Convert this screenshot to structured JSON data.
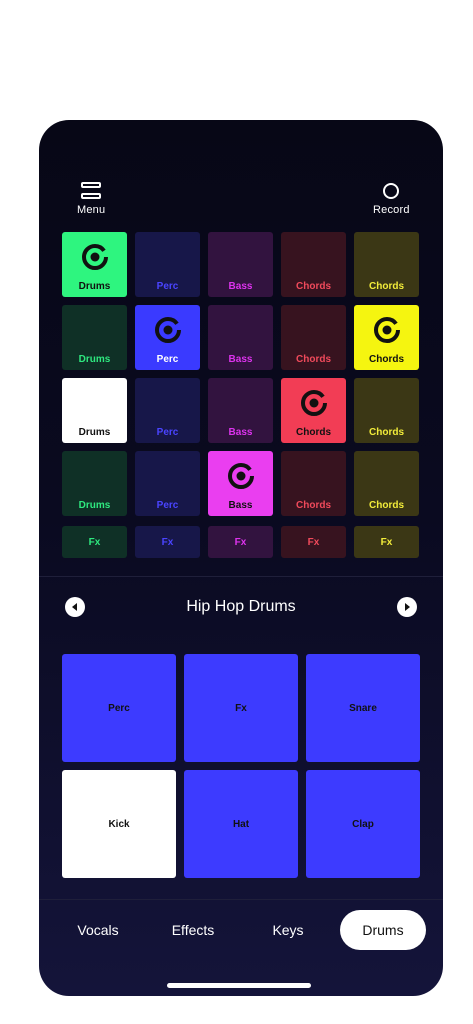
{
  "header": {
    "menu_label": "Menu",
    "record_label": "Record"
  },
  "launch_grid": {
    "rows": [
      [
        {
          "label": "Drums",
          "bg": "#2ef57f",
          "fg": "#111111",
          "active": true
        },
        {
          "label": "Perc",
          "bg": "#171749",
          "fg": "#4a44ff",
          "active": false
        },
        {
          "label": "Bass",
          "bg": "#32133f",
          "fg": "#dd33ee",
          "active": false
        },
        {
          "label": "Chords",
          "bg": "#37131f",
          "fg": "#f04a5b",
          "active": false
        },
        {
          "label": "Chords",
          "bg": "#3b3715",
          "fg": "#f2ec3a",
          "active": false
        }
      ],
      [
        {
          "label": "Drums",
          "bg": "#0f3026",
          "fg": "#2ee87f",
          "active": false
        },
        {
          "label": "Perc",
          "bg": "#3a3aff",
          "fg": "#ffffff",
          "active": true
        },
        {
          "label": "Bass",
          "bg": "#32133f",
          "fg": "#dd33ee",
          "active": false
        },
        {
          "label": "Chords",
          "bg": "#37131f",
          "fg": "#f04a5b",
          "active": false
        },
        {
          "label": "Chords",
          "bg": "#f5f510",
          "fg": "#111111",
          "active": true
        }
      ],
      [
        {
          "label": "Drums",
          "bg": "#ffffff",
          "fg": "#111111",
          "active": false
        },
        {
          "label": "Perc",
          "bg": "#171749",
          "fg": "#4a44ff",
          "active": false
        },
        {
          "label": "Bass",
          "bg": "#32133f",
          "fg": "#dd33ee",
          "active": false
        },
        {
          "label": "Chords",
          "bg": "#f23d55",
          "fg": "#111111",
          "active": true
        },
        {
          "label": "Chords",
          "bg": "#3b3715",
          "fg": "#f2ec3a",
          "active": false
        }
      ],
      [
        {
          "label": "Drums",
          "bg": "#0f3026",
          "fg": "#2ee87f",
          "active": false
        },
        {
          "label": "Perc",
          "bg": "#171749",
          "fg": "#4a44ff",
          "active": false
        },
        {
          "label": "Bass",
          "bg": "#ea3ef0",
          "fg": "#111111",
          "active": true
        },
        {
          "label": "Chords",
          "bg": "#37131f",
          "fg": "#f04a5b",
          "active": false
        },
        {
          "label": "Chords",
          "bg": "#3b3715",
          "fg": "#f2ec3a",
          "active": false
        }
      ]
    ],
    "fx_row": [
      {
        "label": "Fx",
        "bg": "#0f3026",
        "fg": "#2ee87f"
      },
      {
        "label": "Fx",
        "bg": "#171749",
        "fg": "#4a44ff"
      },
      {
        "label": "Fx",
        "bg": "#32133f",
        "fg": "#dd33ee"
      },
      {
        "label": "Fx",
        "bg": "#37131f",
        "fg": "#f04a5b"
      },
      {
        "label": "Fx",
        "bg": "#3b3715",
        "fg": "#f2ec3a"
      }
    ]
  },
  "kit": {
    "title": "Hip Hop Drums",
    "prev_icon": "chevron-left-icon",
    "next_icon": "chevron-right-icon"
  },
  "pads": [
    {
      "label": "Perc",
      "active": false
    },
    {
      "label": "Fx",
      "active": false
    },
    {
      "label": "Snare",
      "active": false
    },
    {
      "label": "Kick",
      "active": true
    },
    {
      "label": "Hat",
      "active": false
    },
    {
      "label": "Clap",
      "active": false
    }
  ],
  "tabs": [
    {
      "label": "Vocals",
      "active": false
    },
    {
      "label": "Effects",
      "active": false
    },
    {
      "label": "Keys",
      "active": false
    },
    {
      "label": "Drums",
      "active": true
    }
  ],
  "colors": {
    "pad_blue": "#3d3bff",
    "accent_white": "#ffffff",
    "background": "#0a0a20"
  }
}
